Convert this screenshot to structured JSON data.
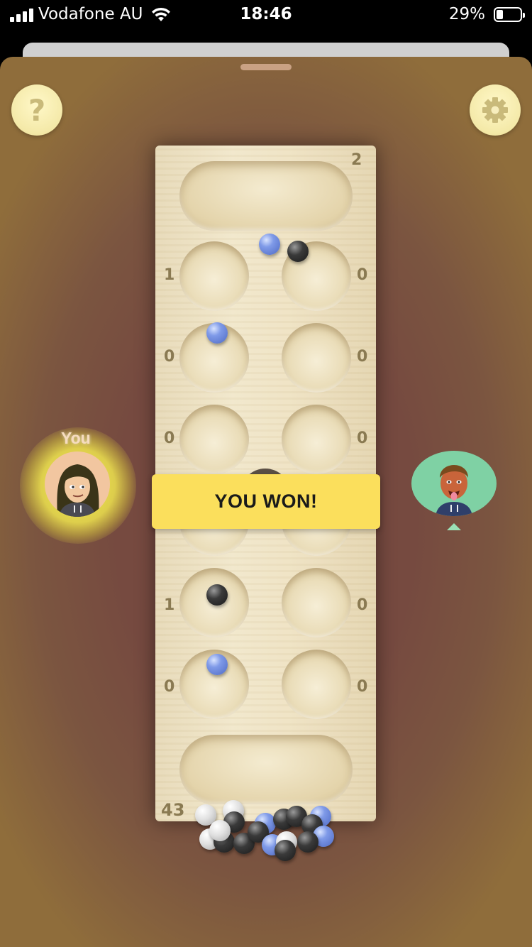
{
  "status_bar": {
    "carrier": "Vodafone AU",
    "time": "18:46",
    "battery_percent": "29%",
    "battery_level": 0.29
  },
  "toolbar": {
    "help_icon": "question-mark-icon",
    "help_label": "?",
    "settings_icon": "gear-icon"
  },
  "board": {
    "top_store_count": "2",
    "bottom_store_count": "43",
    "left_pits": [
      "1",
      "0",
      "0",
      "",
      "1",
      "0"
    ],
    "right_pits": [
      "0",
      "0",
      "0",
      "",
      "0",
      "0"
    ]
  },
  "result": {
    "banner": "YOU WON!"
  },
  "players": {
    "you_label": "You"
  },
  "colors": {
    "banner": "#fbdf5c",
    "winner_glow": "#fff650",
    "opponent_avatar_bg": "#7fd1a4",
    "stone_blue": "#7f9ae8",
    "stone_black": "#2a2a2a"
  }
}
